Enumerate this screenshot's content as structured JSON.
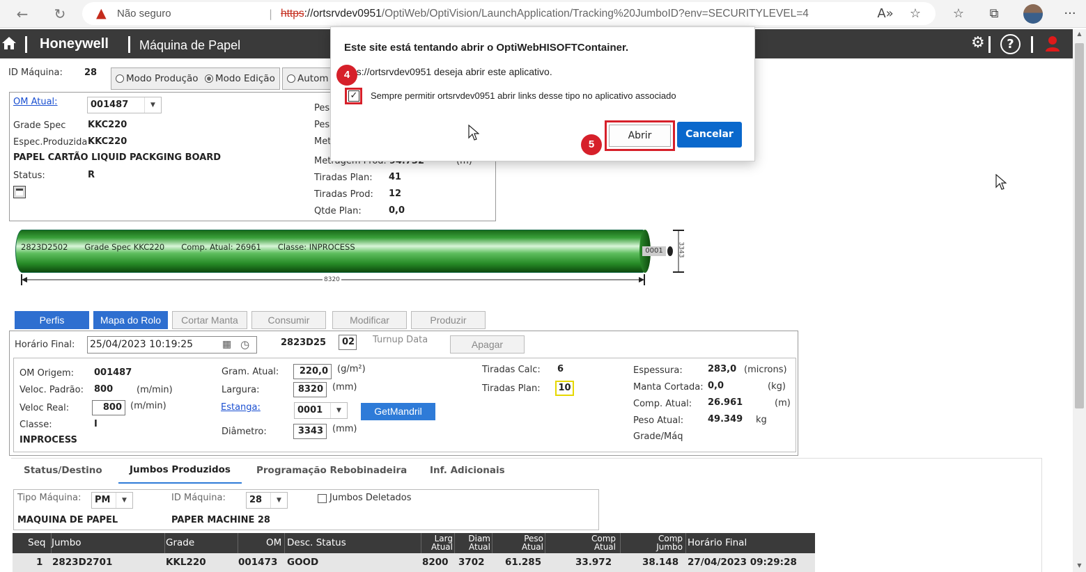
{
  "browser": {
    "security_label": "Não seguro",
    "url_protocol": "https",
    "url_host": "://ortsrvdev0951",
    "url_path": "/OptiWeb/OptiVision/LaunchApplication/Tracking%20JumboID?env=SECURITYLEVEL=4"
  },
  "header": {
    "brand": "Honeywell",
    "title": "Máquina de Papel",
    "help_glyph": "?"
  },
  "machine": {
    "id_label": "ID Máquina:",
    "id_value": "28",
    "modes": [
      "Modo Produção",
      "Modo Edição",
      "Autom"
    ],
    "selected_mode": "Modo Edição"
  },
  "order": {
    "om_label": "OM Atual:",
    "om_value": "001487",
    "grade_spec_label": "Grade Spec",
    "grade_spec_value": "KKC220",
    "espec_label": "Espec.Produzida",
    "espec_value": "KKC220",
    "product_name": "PAPEL CARTÃO LIQUID PACKGING BOARD",
    "status_label": "Status:",
    "status_value": "R",
    "right_labels": [
      "Pes",
      "Pes",
      "Met"
    ],
    "metragem_label": "Metragem Prod.",
    "metragem_value": "94.732",
    "metragem_unit": "(m)",
    "tiradas_plan_label": "Tiradas Plan:",
    "tiradas_plan_value": "41",
    "tiradas_prod_label": "Tiradas Prod:",
    "tiradas_prod_value": "12",
    "qtde_plan_label": "Qtde Plan:",
    "qtde_plan_value": "0,0"
  },
  "roll": {
    "id": "2823D2502",
    "grade": "Grade Spec KKC220",
    "comp": "Comp. Atual: 26961",
    "classe": "Classe: INPROCESS",
    "core": "0001",
    "width_dim": "8320",
    "diameter_dim": "3343"
  },
  "action_buttons": [
    "Perfis",
    "Mapa do Rolo",
    "Cortar Manta",
    "Consumir",
    "Modificar",
    "Produzir"
  ],
  "finish": {
    "horario_label": "Horário Final:",
    "horario_value": "25/04/2023 10:19:25",
    "jumbo_id": "2823D25",
    "jumbo_seq": "02",
    "turnup_label": "Turnup Data",
    "apagar_label": "Apagar"
  },
  "details": {
    "om_origem_label": "OM Origem:",
    "om_origem_value": "001487",
    "veloc_padrao_label": "Veloc. Padrão:",
    "veloc_padrao_value": "800",
    "veloc_padrao_unit": "(m/min)",
    "veloc_real_label": "Veloc Real:",
    "veloc_real_value": "800",
    "veloc_real_unit": "(m/min)",
    "classe_label": "Classe:",
    "classe_value": "I",
    "classe_name": "INPROCESS",
    "gram_label": "Gram. Atual:",
    "gram_value": "220,0",
    "gram_unit": "(g/m²)",
    "largura_label": "Largura:",
    "largura_value": "8320",
    "largura_unit": "(mm)",
    "estanga_label": "Estanga:",
    "estanga_value": "0001",
    "getmandril_label": "GetMandril",
    "diametro_label": "Diâmetro:",
    "diametro_value": "3343",
    "diametro_unit": "(mm)",
    "tiradas_calc_label": "Tiradas Calc:",
    "tiradas_calc_value": "6",
    "tiradas_plan_label": "Tiradas Plan:",
    "tiradas_plan_value": "10",
    "espessura_label": "Espessura:",
    "espessura_value": "283,0",
    "espessura_unit": "(microns)",
    "manta_label": "Manta Cortada:",
    "manta_value": "0,0",
    "manta_unit": "(kg)",
    "comp_label": "Comp. Atual:",
    "comp_value": "26.961",
    "comp_unit": "(m)",
    "peso_label": "Peso Atual:",
    "peso_value": "49.349",
    "peso_unit": "kg",
    "grade_maq_label": "Grade/Máq"
  },
  "tabs": [
    "Status/Destino",
    "Jumbos Produzidos",
    "Programação Rebobinadeira",
    "Inf. Adicionais"
  ],
  "active_tab": "Jumbos Produzidos",
  "filter": {
    "tipo_label": "Tipo Máquina:",
    "tipo_value": "PM",
    "id_label": "ID Máquina:",
    "id_value": "28",
    "deleted_label": "Jumbos Deletados",
    "tipo_name": "MAQUINA DE PAPEL",
    "machine_name": "PAPER MACHINE 28"
  },
  "table": {
    "columns": [
      "Seq",
      "Jumbo",
      "Grade",
      "OM",
      "Desc. Status",
      "Larg Atual",
      "Diam Atual",
      "Peso Atual",
      "Comp Atual",
      "Comp Jumbo",
      "Horário Final"
    ],
    "rows": [
      [
        "1",
        "2823D2701",
        "KKL220",
        "001473",
        "GOOD",
        "8200",
        "3702",
        "61.285",
        "33.972",
        "38.148",
        "27/04/2023 09:29:28"
      ]
    ]
  },
  "dialog": {
    "title": "Este site está tentando abrir o OptiWebHISOFTContainer.",
    "message": "ps://ortsrvdev0951 deseja abrir este aplicativo.",
    "checkbox_label": "Sempre permitir ortsrvdev0951 abrir links desse tipo no aplicativo associado",
    "checked": true,
    "open_label": "Abrir",
    "cancel_label": "Cancelar"
  },
  "steps": [
    "4",
    "5"
  ],
  "colors": {
    "accent": "#2e7bd8",
    "header_bg": "#3a3a3a",
    "highlight": "#d6202a",
    "roll_green": "#3aa03a"
  }
}
